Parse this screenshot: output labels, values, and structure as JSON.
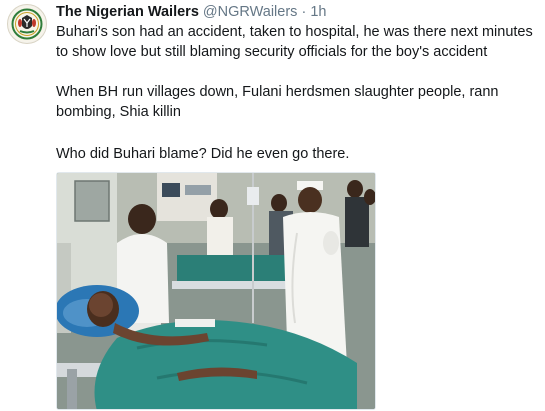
{
  "tweet": {
    "author_name": "The Nigerian Wailers",
    "author_handle": "@NGRWailers",
    "separator": "·",
    "timestamp": "1h",
    "paragraph_1": "Buhari's son had an accident, taken to hospital, he was there next minutes to show love but still blaming security officials for the boy's accident",
    "paragraph_2": "When BH run villages down, Fulani herdsmen slaughter people, rann bombing, Shia killin",
    "paragraph_3": "Who did Buhari blame? Did he even go there.",
    "avatar_icon": "nigerian-coat-of-arms-icon",
    "photo_icon": "hospital-ward-photo"
  },
  "colors": {
    "name": "#14171a",
    "meta": "#657786",
    "text": "#14171a",
    "sheet_green": "#2f8f86",
    "background": "#ffffff"
  }
}
